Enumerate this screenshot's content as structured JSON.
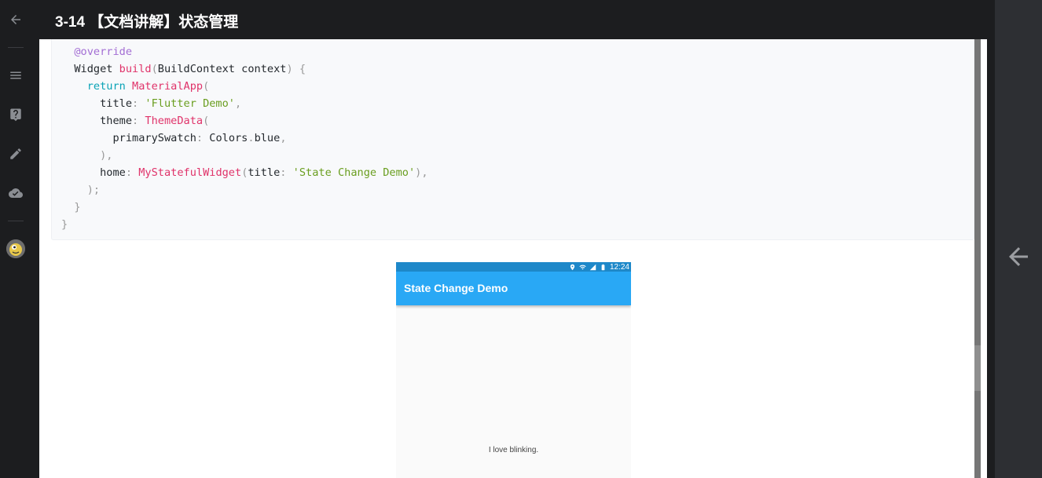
{
  "header": {
    "title": "3-14 【文档讲解】状态管理"
  },
  "sidebar": {
    "back_icon": "arrow-left-icon",
    "items": [
      {
        "icon": "menu-icon"
      },
      {
        "icon": "help-icon"
      },
      {
        "icon": "edit-icon"
      },
      {
        "icon": "cloud-done-icon"
      }
    ],
    "avatar": "user-avatar"
  },
  "code": {
    "lines": [
      {
        "indent": "  ",
        "parts": [
          {
            "t": "@override",
            "c": "ann"
          }
        ]
      },
      {
        "indent": "  ",
        "parts": [
          {
            "t": "Widget ",
            "c": "txt"
          },
          {
            "t": "build",
            "c": "fn"
          },
          {
            "t": "(",
            "c": "pun"
          },
          {
            "t": "BuildContext context",
            "c": "txt"
          },
          {
            "t": ") {",
            "c": "pun"
          }
        ]
      },
      {
        "indent": "    ",
        "parts": [
          {
            "t": "return ",
            "c": "kw"
          },
          {
            "t": "MaterialApp",
            "c": "fn"
          },
          {
            "t": "(",
            "c": "pun"
          }
        ]
      },
      {
        "indent": "      ",
        "parts": [
          {
            "t": "title",
            "c": "txt"
          },
          {
            "t": ": ",
            "c": "pun"
          },
          {
            "t": "'Flutter Demo'",
            "c": "str"
          },
          {
            "t": ",",
            "c": "pun"
          }
        ]
      },
      {
        "indent": "      ",
        "parts": [
          {
            "t": "theme",
            "c": "txt"
          },
          {
            "t": ": ",
            "c": "pun"
          },
          {
            "t": "ThemeData",
            "c": "fn"
          },
          {
            "t": "(",
            "c": "pun"
          }
        ]
      },
      {
        "indent": "        ",
        "parts": [
          {
            "t": "primarySwatch",
            "c": "txt"
          },
          {
            "t": ": ",
            "c": "pun"
          },
          {
            "t": "Colors",
            "c": "txt"
          },
          {
            "t": ".",
            "c": "pun"
          },
          {
            "t": "blue",
            "c": "txt"
          },
          {
            "t": ",",
            "c": "pun"
          }
        ]
      },
      {
        "indent": "      ",
        "parts": [
          {
            "t": "),",
            "c": "pun"
          }
        ]
      },
      {
        "indent": "      ",
        "parts": [
          {
            "t": "home",
            "c": "txt"
          },
          {
            "t": ": ",
            "c": "pun"
          },
          {
            "t": "MyStatefulWidget",
            "c": "fn"
          },
          {
            "t": "(",
            "c": "pun"
          },
          {
            "t": "title",
            "c": "txt"
          },
          {
            "t": ": ",
            "c": "pun"
          },
          {
            "t": "'State Change Demo'",
            "c": "str"
          },
          {
            "t": "),",
            "c": "pun"
          }
        ]
      },
      {
        "indent": "    ",
        "parts": [
          {
            "t": ");",
            "c": "pun"
          }
        ]
      },
      {
        "indent": "  ",
        "parts": [
          {
            "t": "}",
            "c": "pun"
          }
        ]
      },
      {
        "indent": "",
        "parts": [
          {
            "t": "}",
            "c": "pun"
          }
        ]
      }
    ]
  },
  "phone": {
    "status_time": "12:24",
    "appbar_title": "State Change Demo",
    "body_text": "I love blinking."
  },
  "right_panel": {
    "icon": "arrow-left-icon"
  },
  "colors": {
    "accent": "#29a8f5",
    "statusbar": "#1e88c9",
    "annotation": "#a36ed4",
    "keyword": "#0aa3b6",
    "function": "#e0336a",
    "string": "#6a9e1f"
  }
}
